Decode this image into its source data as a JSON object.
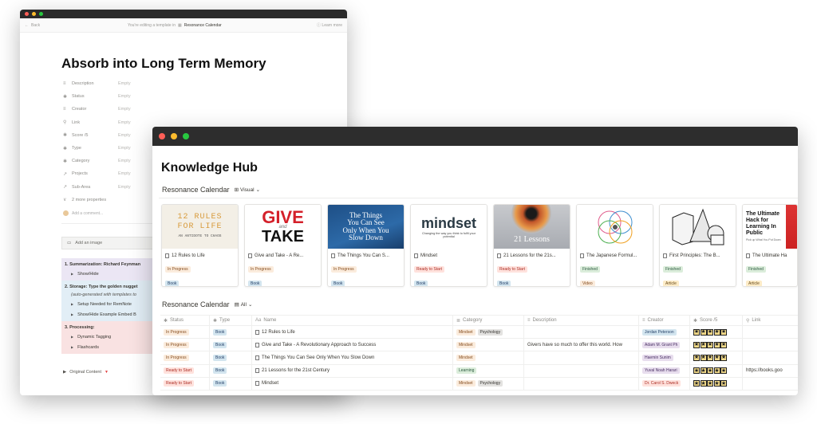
{
  "back_window": {
    "topbar": {
      "back_label": "Back",
      "editing_prefix": "You're editing a template in",
      "db_name": "Resonance Calendar",
      "learn_more": "Learn more"
    },
    "title": "Absorb into Long Term Memory",
    "properties": [
      {
        "icon": "≡",
        "label": "Description",
        "value": "Empty"
      },
      {
        "icon": "✱",
        "label": "Status",
        "value": "Empty"
      },
      {
        "icon": "≡",
        "label": "Creator",
        "value": "Empty"
      },
      {
        "icon": "⚲",
        "label": "Link",
        "value": "Empty"
      },
      {
        "icon": "✱",
        "label": "Score /5",
        "value": "Empty"
      },
      {
        "icon": "✱",
        "label": "Type",
        "value": "Empty"
      },
      {
        "icon": "✱",
        "label": "Category",
        "value": "Empty"
      },
      {
        "icon": "↗",
        "label": "Projects",
        "value": "Empty"
      },
      {
        "icon": "↗",
        "label": "Sub-Area",
        "value": "Empty"
      },
      {
        "icon": "∨",
        "label": "2 more properties",
        "value": ""
      }
    ],
    "add_comment": "Add a comment...",
    "add_image": "Add an image",
    "sections": {
      "s1_heading": "1. Summarization: Richard Feynman",
      "s1_item": "Show/Hide",
      "s2_heading": "2. Storage: Type the golden nugget",
      "s2_note": "(auto-generated with templates to",
      "s2_item1": "Setup Needed for RemNote",
      "s2_item2": "Show/Hide Example Embed B",
      "s3_heading": "3. Processing:",
      "s3_item1": "Dynamic Tagging",
      "s3_item2": "Flashcards"
    },
    "original_content": "Original Content"
  },
  "front_window": {
    "title": "Knowledge Hub",
    "gallery_view": {
      "db_name": "Resonance Calendar",
      "view_label": "Visual"
    },
    "cards": [
      {
        "title": "12 Rules to Life",
        "status": "In Progress",
        "status_class": "t-progress",
        "type": "Book",
        "type_class": "t-book",
        "cover": "rules"
      },
      {
        "title": "Give and Take - A Re...",
        "status": "In Progress",
        "status_class": "t-progress",
        "type": "Book",
        "type_class": "t-book",
        "cover": "give"
      },
      {
        "title": "The Things You Can S...",
        "status": "In Progress",
        "status_class": "t-progress",
        "type": "Book",
        "type_class": "t-book",
        "cover": "things"
      },
      {
        "title": "Mindset",
        "status": "Ready to Start",
        "status_class": "t-ready",
        "type": "Book",
        "type_class": "t-book",
        "cover": "mindset"
      },
      {
        "title": "21 Lessons for the 21s...",
        "status": "Ready to Start",
        "status_class": "t-ready",
        "type": "Book",
        "type_class": "t-book",
        "cover": "lessons"
      },
      {
        "title": "The Japanese Formul...",
        "status": "Finished",
        "status_class": "t-finished",
        "type": "Video",
        "type_class": "t-video",
        "cover": "venn"
      },
      {
        "title": "First Principles: The B...",
        "status": "Finished",
        "status_class": "t-finished",
        "type": "Article",
        "type_class": "t-article",
        "cover": "shapes"
      },
      {
        "title": "The Ultimate Ha",
        "status": "Finished",
        "status_class": "t-finished",
        "type": "Article",
        "type_class": "t-article",
        "cover": "ultimate"
      }
    ],
    "covers": {
      "rules_line1": "12 RULES",
      "rules_line2": "FOR LIFE",
      "rules_sub": "AN ANTIDOTE TO CHAOS",
      "give_line1": "GIVE",
      "give_and": "and",
      "give_line2": "TAKE",
      "things_l1": "The Things",
      "things_l2": "You Can See",
      "things_l3": "Only When You",
      "things_l4": "Slow Down",
      "mindset": "mindset",
      "mindset_sub": "Changing the way you think to fulfil your potential",
      "lessons": "21 Lessons",
      "ultimate_l1": "The Ultimate",
      "ultimate_l2": "Hack for",
      "ultimate_l3": "Learning In",
      "ultimate_l4": "Public",
      "ultimate_sub": "Pick up What You Put Down"
    },
    "table_view": {
      "db_name": "Resonance Calendar",
      "view_label": "All"
    },
    "columns": {
      "status": "Status",
      "type": "Type",
      "name": "Name",
      "category": "Category",
      "description": "Description",
      "creator": "Creator",
      "score": "Score /5",
      "link": "Link"
    },
    "rows": [
      {
        "status": "In Progress",
        "status_class": "t-progress",
        "type": "Book",
        "name": "12 Rules to Life",
        "categories": [
          "Mindset",
          "Psychology"
        ],
        "description": "",
        "creator": "Jordan Peterson",
        "creator_class": "t-creator",
        "score": "★★★★★",
        "link": ""
      },
      {
        "status": "In Progress",
        "status_class": "t-progress",
        "type": "Book",
        "name": "Give and Take - A Revolutionary Approach to Success",
        "categories": [
          "Mindset"
        ],
        "description": "Givers have so much to offer this world. How",
        "creator": "Adam M. Grant Ph",
        "creator_class": "t-creator3",
        "score": "★★★★★",
        "link": ""
      },
      {
        "status": "In Progress",
        "status_class": "t-progress",
        "type": "Book",
        "name": "The Things You Can See Only When You Slow Down",
        "categories": [
          "Mindset"
        ],
        "description": "",
        "creator": "Haemin Sunim",
        "creator_class": "t-creator3",
        "score": "★★★★★",
        "link": ""
      },
      {
        "status": "Ready to Start",
        "status_class": "t-ready",
        "type": "Book",
        "name": "21 Lessons for the 21st Century",
        "categories": [
          "Learning"
        ],
        "description": "",
        "creator": "Yuval Noah Harari",
        "creator_class": "t-creator3",
        "score": "★★★★★",
        "link": "https://books.goo"
      },
      {
        "status": "Ready to Start",
        "status_class": "t-ready",
        "type": "Book",
        "name": "Mindset",
        "categories": [
          "Mindset",
          "Psychology"
        ],
        "description": "",
        "creator": "Dr. Carol S. Dweck",
        "creator_class": "t-creator2",
        "score": "★★★★★",
        "link": ""
      }
    ]
  }
}
